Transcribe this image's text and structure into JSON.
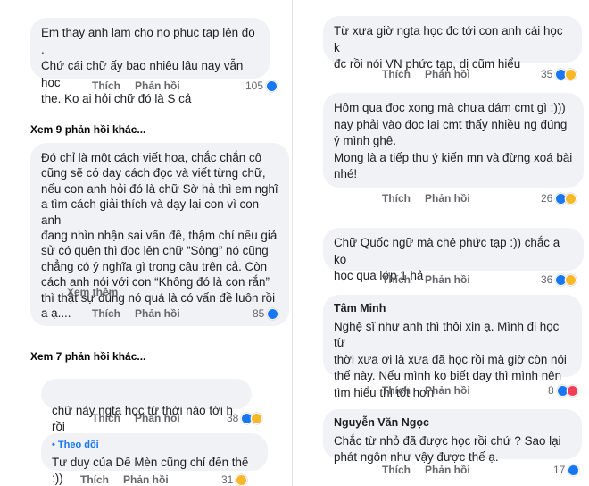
{
  "left": {
    "c1": {
      "text": "Em thay anh lam cho no phuc tap lên đo .\nChứ cái chữ ấy bao nhiêu lâu nay vẫn học\nthe. Ko ai hỏi chữ đó là S cả",
      "like": "Thích",
      "reply": "Phản hồi",
      "count": "105"
    },
    "more1": "Xem 9 phản hồi khác...",
    "c2": {
      "text": "Đó chỉ là một cách viết hoa, chắc chắn cô\ncũng sẽ có dạy cách đọc và viết từng chữ,\nnếu con anh hỏi đó là chữ Sờ hả thì em nghĩ\na tìm cách giải thích và dạy lại con vì con anh\nđang nhìn nhận sai vấn đề, thậm chí nếu giả\nsử có quên thì đọc lên chữ “Sòng” nó cũng\nchẳng có ý nghĩa gì trong câu trên cả. Còn\ncách anh nói với con “Không đó là con rắn”\nthì thật sự đúng nó quá là có vấn đề luôn rồi\na ạ....",
      "see_more": "Xem thêm",
      "like": "Thích",
      "reply": "Phản hồi",
      "count": "85"
    },
    "more2": "Xem 7 phản hồi khác...",
    "c3": {
      "text": "chữ này ngta học từ thời nào tới h rồi",
      "like": "Thích",
      "reply": "Phản hồi",
      "count": "38"
    },
    "c4": {
      "follow": "• Theo dõi",
      "text": "Tư duy của Dế Mèn cũng chỉ đến thế :))",
      "like": "Thích",
      "reply": "Phản hồi",
      "count": "31"
    }
  },
  "right": {
    "c1": {
      "text": "Từ xưa giờ ngta học đc tới con anh cái học k\nđc rồi nói VN phức tạp, dị cũm hiểu",
      "like": "Thích",
      "reply": "Phản hồi",
      "count": "35"
    },
    "c2": {
      "text": "Hôm qua đọc xong mà chưa dám cmt gì :)))\nnay phải vào đọc lại cmt thấy nhiều ng đúng\ný mình ghê.\nMong là a tiếp thu ý kiến mn và đừng xoá bài\nnhé!",
      "like": "Thích",
      "reply": "Phản hồi",
      "count": "26"
    },
    "c3": {
      "text": "Chữ Quốc ngữ mà chê phức tạp :)) chắc a ko\nhọc qua lớp 1 hả",
      "like": "Thích",
      "reply": "Phản hồi",
      "count": "36"
    },
    "c4": {
      "author": "Tâm Minh",
      "text": "Nghệ sĩ như anh thì thôi xin ạ. Mình đi học từ\nthời xưa ơi là xưa đã học rồi mà giờ còn nói\nthế này. Nếu mình ko biết dạy thì mình nên\ntìm hiểu thì tốt hơn",
      "like": "Thích",
      "reply": "Phản hồi",
      "count": "8"
    },
    "c5": {
      "author": "Nguyễn Văn Ngọc",
      "text": "Chắc từ nhỏ đã được học rồi chứ ? Sao lại\nphát ngôn như vậy được thế ạ.",
      "like": "Thích",
      "reply": "Phản hồi",
      "count": "17"
    }
  },
  "colors": {
    "bubble": "#f0f2f5",
    "meta": "#65676b",
    "like": "#1877f2",
    "haha": "#f7b928",
    "love": "#f33e58"
  },
  "icons": [
    "like-reaction-icon",
    "haha-reaction-icon",
    "sad-reaction-icon",
    "love-reaction-icon"
  ]
}
